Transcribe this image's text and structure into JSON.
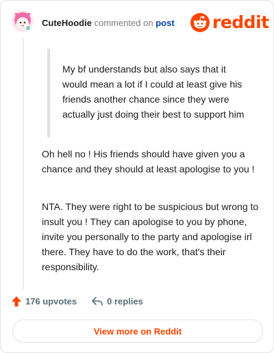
{
  "colors": {
    "brand": "#ff4500",
    "link": "#0045ac",
    "muted": "#7c7c7c",
    "actions": "#576f76"
  },
  "header": {
    "username": "CuteHoodie",
    "commented_on": "commented on",
    "post_link": "post",
    "avatar_icon": "pink-haired-avatar",
    "logo_icon": "reddit-snoo-icon",
    "logo_text": "reddit"
  },
  "comment": {
    "quote": "My bf understands but also says that it would mean a lot if I could at least give his friends another chance since they were actually just doing their best to support him",
    "paragraphs": [
      "Oh hell no ! His friends should have given you a chance and they should at least apologise to you !",
      "NTA. They were right to be suspicious but wrong to insult you ! They can apologise to you by phone, invite you personally to the party and apologise irl there. They have to do the work, that's their responsibility."
    ]
  },
  "actions": {
    "upvotes": "176 upvotes",
    "upvote_icon": "upvote-arrow-icon",
    "replies": "0 replies",
    "reply_icon": "reply-arrow-icon"
  },
  "footer": {
    "view_more": "View more on Reddit"
  }
}
